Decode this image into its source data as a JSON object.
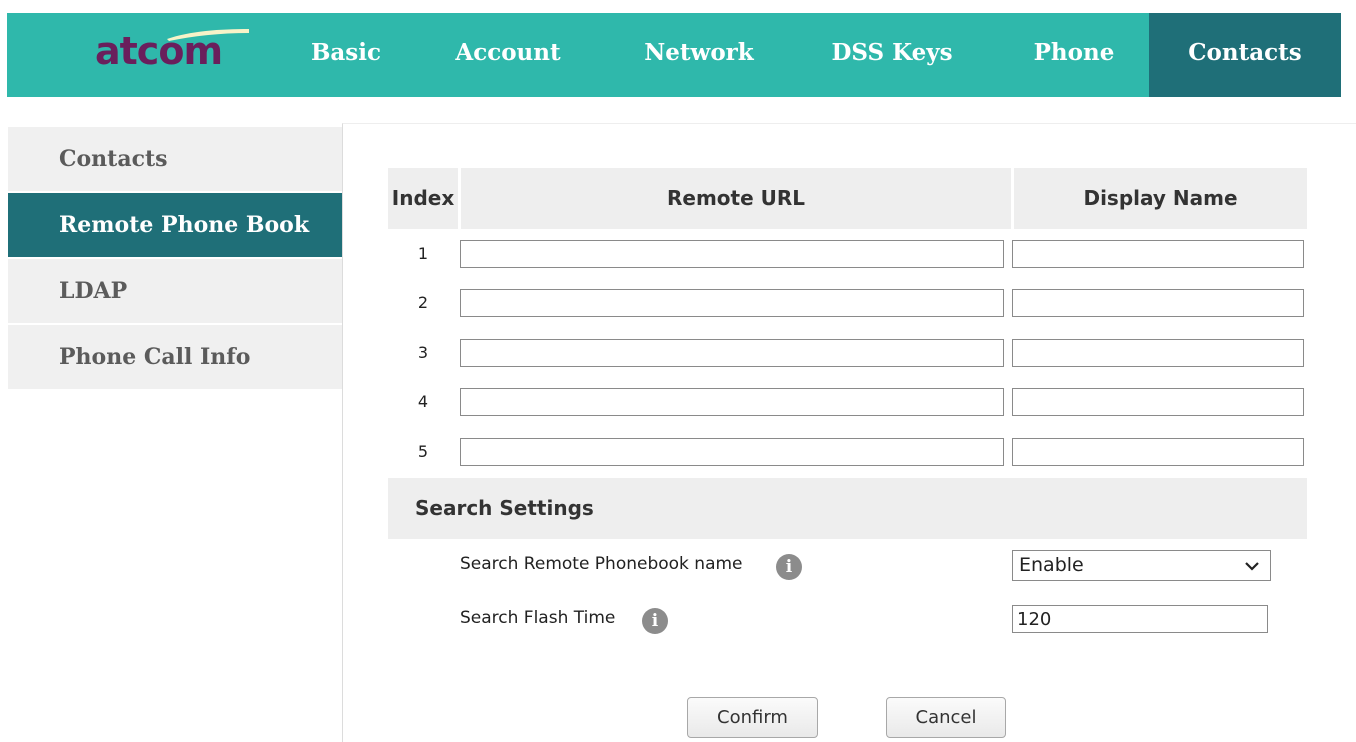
{
  "brand": {
    "logo_text": "atcom",
    "colors": {
      "header": "#2fb8ab",
      "active": "#1f6f78",
      "logo": "#6a1f5c"
    }
  },
  "nav": {
    "items": [
      {
        "label": "Basic"
      },
      {
        "label": "Account"
      },
      {
        "label": "Network"
      },
      {
        "label": "DSS Keys"
      },
      {
        "label": "Phone"
      },
      {
        "label": "Contacts",
        "active": true
      }
    ]
  },
  "sidebar": {
    "items": [
      {
        "label": "Contacts"
      },
      {
        "label": "Remote Phone Book",
        "active": true
      },
      {
        "label": "LDAP"
      },
      {
        "label": "Phone Call Info"
      }
    ]
  },
  "table": {
    "headers": {
      "index": "Index",
      "remote_url": "Remote URL",
      "display_name": "Display Name"
    },
    "rows": [
      {
        "index": "1",
        "remote_url": "",
        "display_name": ""
      },
      {
        "index": "2",
        "remote_url": "",
        "display_name": ""
      },
      {
        "index": "3",
        "remote_url": "",
        "display_name": ""
      },
      {
        "index": "4",
        "remote_url": "",
        "display_name": ""
      },
      {
        "index": "5",
        "remote_url": "",
        "display_name": ""
      }
    ]
  },
  "search_settings": {
    "title": "Search Settings",
    "remote_name": {
      "label": "Search Remote Phonebook name",
      "value": "Enable",
      "options": [
        "Enable"
      ]
    },
    "flash_time": {
      "label": "Search Flash Time",
      "value": "120"
    },
    "info_glyph": "i"
  },
  "buttons": {
    "confirm": "Confirm",
    "cancel": "Cancel"
  }
}
